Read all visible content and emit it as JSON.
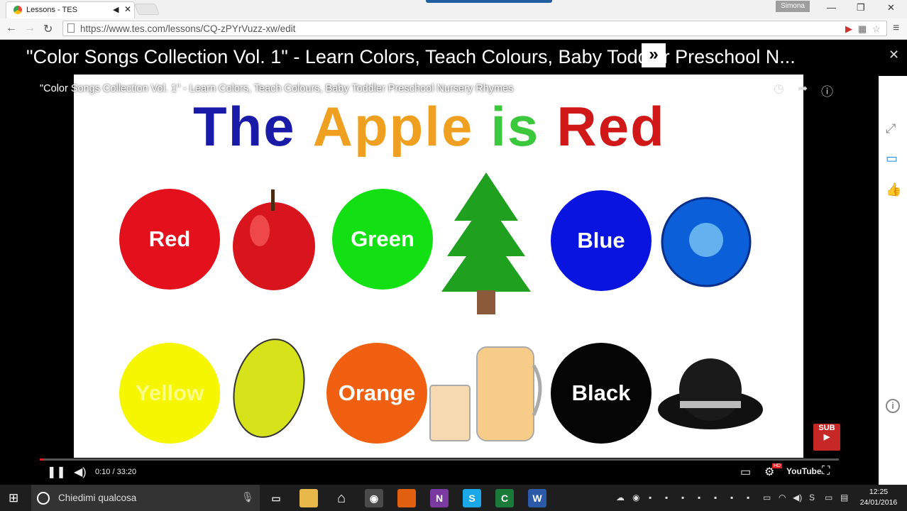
{
  "browser": {
    "tab_title": "Lessons - TES",
    "tab_audio_icon": "speaker-icon",
    "profile_name": "Simona",
    "url": "https://www.tes.com/lessons/CQ-zPYrVuzz-xw/edit"
  },
  "lesson": {
    "title": "\"Color Songs Collection Vol. 1\" - Learn Colors, Teach Colours, Baby Toddler Preschool N...",
    "expand_label": "»"
  },
  "video": {
    "title": "\"Color Songs Collection Vol. 1\" - Learn Colors, Teach Colours, Baby Toddler Preschool Nursery Rhymes",
    "headline": {
      "w1": "The",
      "w2": "Apple",
      "w3": "is",
      "w4": "Red"
    },
    "colors": {
      "red": "Red",
      "green": "Green",
      "blue": "Blue",
      "yellow": "Yellow",
      "orange": "Orange",
      "black": "Black"
    },
    "subscribe_label": "SUB",
    "time_current": "0:10",
    "time_total": "33:20",
    "time_separator": " / ",
    "progress_fraction": 0.005,
    "hd_badge": "HD",
    "youtube_label": "YouTube"
  },
  "taskbar": {
    "search_placeholder": "Chiedimi qualcosa",
    "time": "12:25",
    "date": "24/01/2016"
  },
  "accents": {
    "chrome_blue": "#1f5fa0",
    "headline_blue": "#1a1aa8",
    "headline_orange": "#f0a020",
    "headline_green": "#3cc83c",
    "headline_red": "#d01818"
  }
}
